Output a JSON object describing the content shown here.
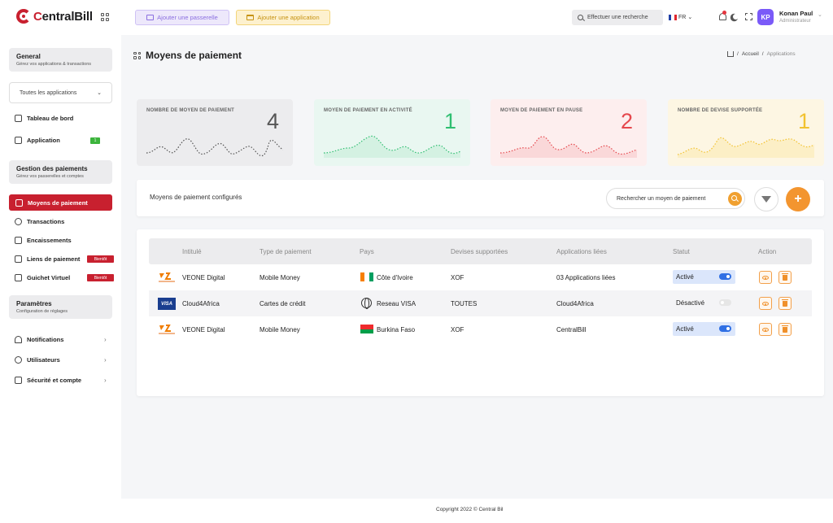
{
  "header": {
    "logo_prefix": "C",
    "logo_text": "entralBill",
    "btn_passerelle": "Ajouter une passerelle",
    "btn_application": "Ajouter une application",
    "search_placeholder": "Effectuer une recherche",
    "lang": "FR",
    "avatar_initials": "KP",
    "user_name": "Konan Paul",
    "user_role": "Administrateur"
  },
  "sidebar": {
    "general": {
      "title": "General",
      "subtitle": "Gérez vos applications & transactions"
    },
    "app_select": "Toutes les applications",
    "dashboard": "Tableau de bord",
    "application": "Application",
    "application_badge": "1",
    "gestion": {
      "title": "Gestion des paiements",
      "subtitle": "Gérez vos passerelles et comptes"
    },
    "moyens": "Moyens de paiement",
    "transactions": "Transactions",
    "encaissements": "Encaissements",
    "liens": "Liens de paiement",
    "liens_badge": "Bientôt",
    "guichet": "Guichet Virtuel",
    "guichet_badge": "Bientôt",
    "parametres": {
      "title": "Paramètres",
      "subtitle": "Configuration de réglages"
    },
    "notifications": "Notifications",
    "utilisateurs": "Utilisateurs",
    "securite": "Sécurité et compte"
  },
  "main": {
    "title": "Moyens de paiement",
    "breadcrumb_home": "Accueil",
    "breadcrumb_sep": "/",
    "breadcrumb_current": "Applications",
    "stats": [
      {
        "label": "NOMBRE DE MOYEN DE PAIEMENT",
        "value": "4",
        "color": "#555555",
        "bg": "#ececee"
      },
      {
        "label": "MOYEN DE PAIEMENT EN ACTIVITÉ",
        "value": "1",
        "color": "#2fbf71",
        "bg": "#e9f7f1"
      },
      {
        "label": "MOYEN DE PAIEMENT EN PAUSE",
        "value": "2",
        "color": "#e5484d",
        "bg": "#fdeeee"
      },
      {
        "label": "NOMBRE DE DEVISE SUPPORTÉE",
        "value": "1",
        "color": "#f2c230",
        "bg": "#fdf6e3"
      }
    ],
    "panel_title": "Moyens de paiement configurés",
    "search_placeholder": "Rechercher un moyen de paiement",
    "add_label": "+",
    "columns": [
      "Intitulé",
      "Type de paiement",
      "Pays",
      "Devises supportées",
      "Applications liées",
      "Statut",
      "Action"
    ],
    "rows": [
      {
        "name": "VEONE Digital",
        "type": "Mobile Money",
        "country": "Côte d'Ivoire",
        "currency": "XOF",
        "apps": "03 Applications liées",
        "status": "Activé"
      },
      {
        "name": "Cloud4Africa",
        "type": "Cartes de crédit",
        "country": "Reseau VISA",
        "currency": "TOUTES",
        "apps": "Cloud4Africa",
        "status": "Désactivé"
      },
      {
        "name": "VEONE Digital",
        "type": "Mobile Money",
        "country": "Burkina Faso",
        "currency": "XOF",
        "apps": "CentralBill",
        "status": "Activé"
      }
    ],
    "visa_label": "VISA"
  },
  "footer": {
    "copyright": "Copyright 2022 © Central Bil"
  }
}
